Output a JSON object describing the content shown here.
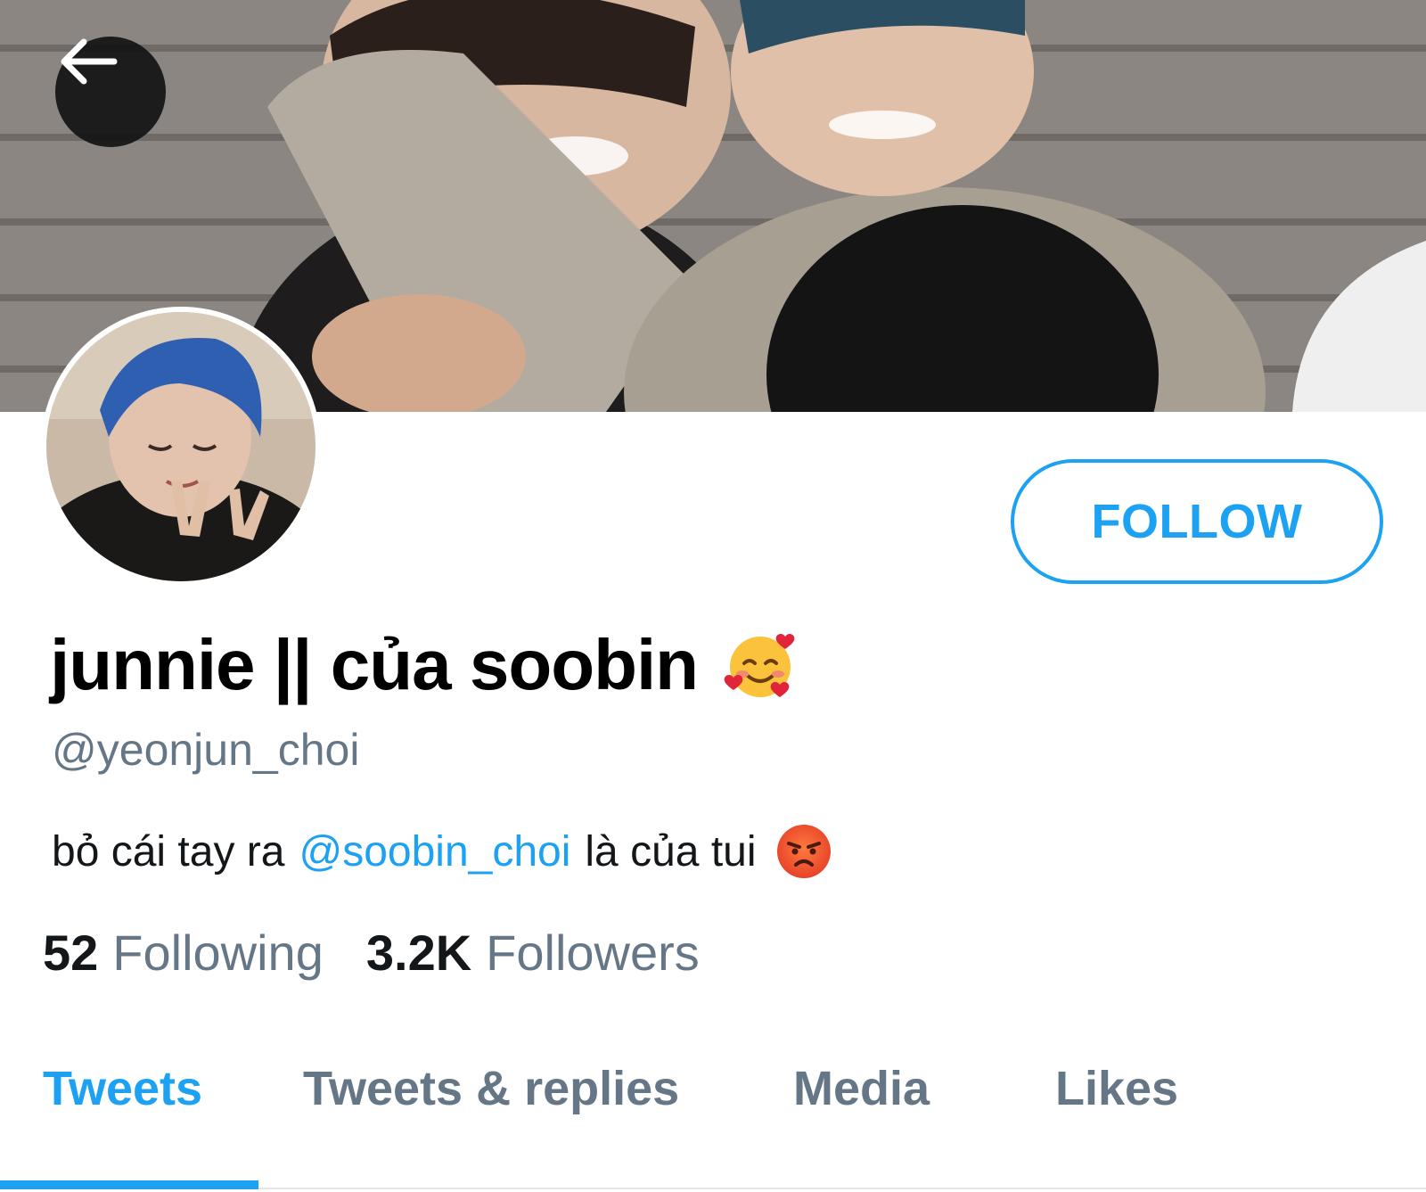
{
  "profile": {
    "display_name": "junnie || của soobin",
    "handle": "@yeonjun_choi",
    "bio_prefix": "bỏ cái tay ra",
    "bio_mention": "@soobin_choi",
    "bio_suffix": "là của tui",
    "name_emoji": "smiling-face-with-hearts",
    "bio_emoji": "pouting-face"
  },
  "actions": {
    "follow_label": "FOLLOW",
    "back_icon": "arrow-left-icon"
  },
  "stats": {
    "following_count": "52",
    "following_label": "Following",
    "followers_count": "3.2K",
    "followers_label": "Followers"
  },
  "tabs": [
    {
      "label": "Tweets",
      "active": true
    },
    {
      "label": "Tweets & replies",
      "active": false
    },
    {
      "label": "Media",
      "active": false
    },
    {
      "label": "Likes",
      "active": false
    }
  ],
  "colors": {
    "accent": "#1da1f2",
    "secondary_text": "#657786",
    "primary_text": "#14171a"
  }
}
